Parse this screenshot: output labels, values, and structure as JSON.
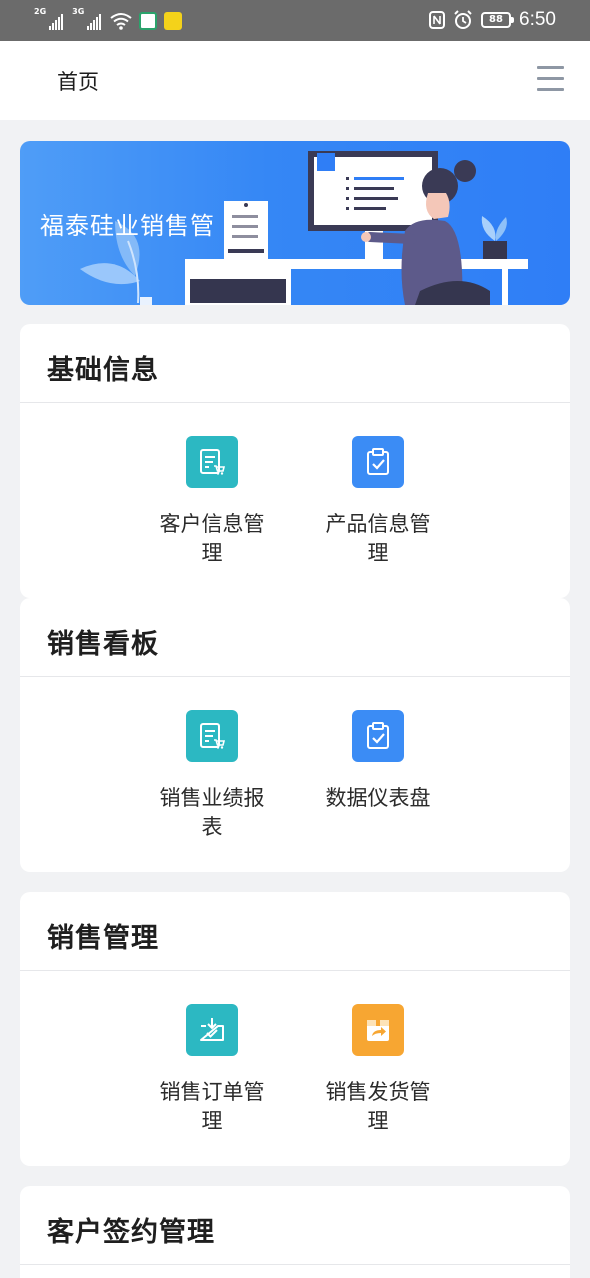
{
  "status_bar": {
    "network_1": "2G",
    "network_2": "3G",
    "battery": "88",
    "time": "6:50"
  },
  "header": {
    "title": "首页"
  },
  "banner": {
    "text": "福泰硅业销售管"
  },
  "sections": [
    {
      "title": "基础信息",
      "items": [
        {
          "label": "客户信息管理",
          "icon": "list-cart-icon",
          "color": "#2cb8c2"
        },
        {
          "label": "产品信息管理",
          "icon": "clipboard-check-icon",
          "color": "#3b8cf5"
        }
      ]
    },
    {
      "title": "销售看板",
      "items": [
        {
          "label": "销售业绩报表",
          "icon": "list-cart-icon",
          "color": "#2cb8c2"
        },
        {
          "label": "数据仪表盘",
          "icon": "clipboard-check-icon",
          "color": "#3b8cf5"
        }
      ]
    },
    {
      "title": "销售管理",
      "items": [
        {
          "label": "销售订单管理",
          "icon": "inbox-download-icon",
          "color": "#2cb8c2"
        },
        {
          "label": "销售发货管理",
          "icon": "box-share-icon",
          "color": "#f7a632"
        }
      ]
    },
    {
      "title": "客户签约管理",
      "items": []
    }
  ]
}
